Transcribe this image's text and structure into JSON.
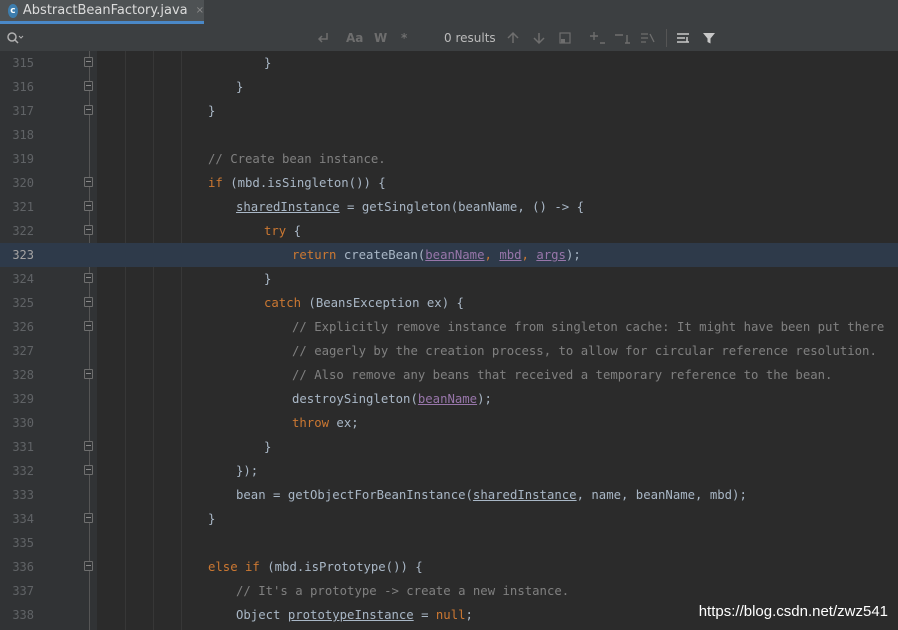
{
  "tab": {
    "icon": "c",
    "filename": "AbstractBeanFactory.java",
    "close": "×"
  },
  "search": {
    "results": "0 results",
    "case_label": "Aa",
    "word_label": "W",
    "regex_label": "*"
  },
  "code_lines": [
    {
      "n": "315"
    },
    {
      "n": "316"
    },
    {
      "n": "317"
    },
    {
      "n": "318"
    },
    {
      "n": "319"
    },
    {
      "n": "320"
    },
    {
      "n": "321"
    },
    {
      "n": "322"
    },
    {
      "n": "323"
    },
    {
      "n": "324"
    },
    {
      "n": "325"
    },
    {
      "n": "326"
    },
    {
      "n": "327"
    },
    {
      "n": "328"
    },
    {
      "n": "329"
    },
    {
      "n": "330"
    },
    {
      "n": "331"
    },
    {
      "n": "332"
    },
    {
      "n": "333"
    },
    {
      "n": "334"
    },
    {
      "n": "335"
    },
    {
      "n": "336"
    },
    {
      "n": "337"
    },
    {
      "n": "338"
    }
  ],
  "code_text": {
    "l315": "}",
    "l316": "}",
    "l317": "}",
    "l319": "// Create bean instance.",
    "l320_kw": "if",
    "l320": " (mbd.isSingleton()) {",
    "l321_a": "sharedInstance",
    "l321_b": " = getSingleton(beanName, () -> {",
    "l322_kw": "try",
    "l322": " {",
    "l323_kw": "return",
    "l323_a": " createBean(",
    "l323_p1": "beanName",
    "l323_sep1": ", ",
    "l323_p2": "mbd",
    "l323_sep2": ", ",
    "l323_p3": "args",
    "l323_end": ");",
    "l324": "}",
    "l325_kw": "catch",
    "l325": " (BeansException ex) {",
    "l326": "// Explicitly remove instance from singleton cache: It might have been put there",
    "l327": "// eagerly by the creation process, to allow for circular reference resolution.",
    "l328": "// Also remove any beans that received a temporary reference to the bean.",
    "l329_a": "destroySingleton(",
    "l329_p": "beanName",
    "l329_end": ");",
    "l330_kw": "throw",
    "l330": " ex;",
    "l331": "}",
    "l332": "});",
    "l333_a": "bean = getObjectForBeanInstance(",
    "l333_u": "sharedInstance",
    "l333_b": ", name, beanName, mbd);",
    "l334": "}",
    "l336_kw": "else if",
    "l336": " (mbd.isPrototype()) {",
    "l337": "// It's a prototype -> create a new instance.",
    "l338_a": "Object ",
    "l338_u": "prototypeInstance",
    "l338_b": " = ",
    "l338_kw": "null",
    "l338_end": ";"
  },
  "watermark": "https://blog.csdn.net/zwz541"
}
